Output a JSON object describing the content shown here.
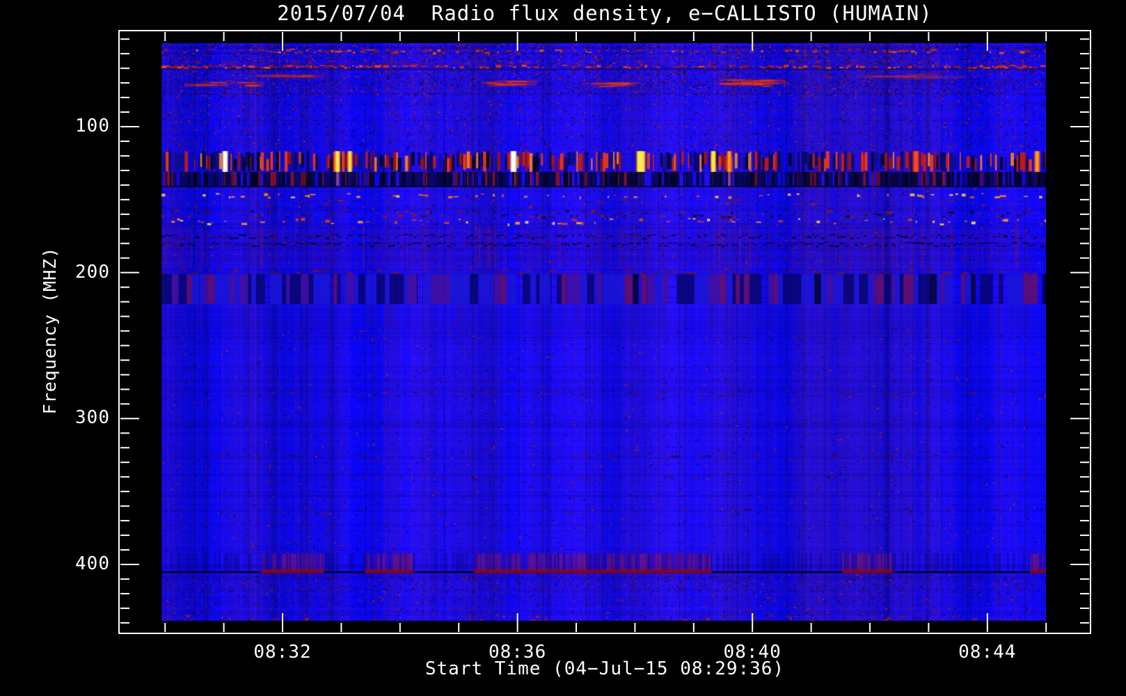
{
  "title": "2015/07/04  Radio flux density, e−CALLISTO (HUMAIN)",
  "axes": {
    "x": {
      "label": "Start Time (04−Jul−15 08:29:36)",
      "ticks": [
        "08:32",
        "08:36",
        "08:40",
        "08:44"
      ]
    },
    "y": {
      "label": "Frequency (MHZ)",
      "ticks": [
        {
          "label": "100",
          "mhz": 100
        },
        {
          "label": "200",
          "mhz": 200
        },
        {
          "label": "300",
          "mhz": 300
        },
        {
          "label": "400",
          "mhz": 400
        }
      ]
    }
  },
  "colors": {
    "background": "#000000",
    "frame": "#ffffff",
    "text": "#ffffff",
    "base_blue": "#1717e8",
    "dark_navy": "#000080",
    "rfi_red": "#cc2200",
    "rfi_orange": "#ff8800",
    "rfi_yellow": "#ffee55",
    "rfi_white": "#ffffff",
    "rfi_purple": "#7a14a0"
  },
  "chart_data": {
    "type": "heatmap",
    "title": "2015/07/04  Radio flux density, e−CALLISTO (HUMAIN)",
    "xlabel": "Start Time (04−Jul−15 08:29:36)",
    "ylabel": "Frequency (MHZ)",
    "start_time": "04-Jul-15 08:29:36",
    "x_tick_labels": [
      "08:32",
      "08:36",
      "08:40",
      "08:44"
    ],
    "x_minor_tick_interval_min": 1,
    "x_major_tick_interval_min": 4,
    "y_tick_labels_mhz": [
      100,
      200,
      300,
      400
    ],
    "y_minor_tick_interval_mhz": 10,
    "freq_range_mhz": [
      42.8,
      438.6
    ],
    "freq_axis_inverted_low_at_top": true,
    "background_character": "uniform blue with fine vertical striping noise",
    "speckle_zones": [
      {
        "f": [
          43.0,
          78.5
        ],
        "count": 9000
      },
      {
        "f": [
          78.5,
          116.5
        ],
        "count": 3800
      },
      {
        "f": [
          141.0,
          196.0
        ],
        "count": 2600
      },
      {
        "f": [
          237.5,
          392.0
        ],
        "count": 5200
      },
      {
        "f": [
          406.0,
          438.5
        ],
        "count": 2600
      }
    ],
    "rfi_bands": [
      {
        "f": [
          46.5,
          49.5
        ],
        "type": "dash_row",
        "palette": "red",
        "density": 0.4,
        "strong": [
          [
            0.1,
            0.155
          ],
          [
            0.175,
            0.235
          ],
          [
            0.82,
            0.87
          ]
        ],
        "desc": "speckled red RFI row near top"
      },
      {
        "f": [
          54.0,
          56.5
        ],
        "type": "dash_row",
        "palette": "red_sparse",
        "density": 0.13,
        "desc": "sparse fine red dots"
      },
      {
        "f": [
          57.5,
          59.7
        ],
        "type": "dash_row",
        "palette": "red_bright",
        "density": 0.5,
        "strong": [
          [
            0.0,
            0.24
          ],
          [
            0.67,
            0.72
          ],
          [
            0.91,
            1.0
          ]
        ],
        "underline": true,
        "desc": "thin bright red dashed line"
      },
      {
        "f": [
          64.5,
          66.5
        ],
        "type": "streaks",
        "alpha": 0.4,
        "segments": [
          [
            0.12,
            0.19
          ],
          [
            0.8,
            0.91
          ]
        ],
        "desc": "faint red fuzz streaks"
      },
      {
        "f": [
          68.0,
          72.5
        ],
        "type": "streaks",
        "alpha": 1.0,
        "segments": [
          [
            0.03,
            0.18
          ],
          [
            0.355,
            0.405
          ],
          [
            0.487,
            0.545
          ],
          [
            0.635,
            0.69
          ]
        ],
        "desc": "strong elongated red streaks"
      },
      {
        "f": [
          116.8,
          131.0
        ],
        "type": "rfi_strong",
        "desc": "strongest RFI band: red/navy bars with white-yellow saturated columns",
        "bright_columns": [
          [
            0.072,
            "white",
            4
          ],
          [
            0.199,
            "yellow",
            4
          ],
          [
            0.213,
            "yellow",
            3
          ],
          [
            0.398,
            "white",
            5
          ],
          [
            0.542,
            "yellow",
            9
          ],
          [
            0.624,
            "yellow",
            4
          ],
          [
            0.642,
            "orange",
            4
          ],
          [
            0.853,
            "bright_red",
            6
          ],
          [
            0.99,
            "orange",
            5
          ]
        ]
      },
      {
        "f": [
          131.0,
          141.0
        ],
        "type": "rfi_dark",
        "desc": "dark navy/black bar band with red bars"
      },
      {
        "f": [
          145.5,
          148.5
        ],
        "type": "dash_row",
        "palette": "orange",
        "density": 0.22,
        "desc": "orange dotted row"
      },
      {
        "f": [
          149.5,
          155.0
        ],
        "type": "dash_row",
        "palette": "red_sparse",
        "density": 0.1
      },
      {
        "f": [
          157.0,
          162.0
        ],
        "type": "dash_row",
        "palette": "dark_red_mix",
        "density": 0.55,
        "desc": "dark+red dashed band"
      },
      {
        "f": [
          162.5,
          167.0
        ],
        "type": "dash_row",
        "palette": "orange_bright",
        "density": 0.28,
        "desc": "bright orange dash row"
      },
      {
        "f": [
          168.5,
          196.5
        ],
        "type": "stripe_fine",
        "desc": "fine blue/purple vertical striping"
      },
      {
        "f": [
          173.5,
          177.0
        ],
        "type": "dark_dash_line"
      },
      {
        "f": [
          179.0,
          182.5
        ],
        "type": "dark_dash_line"
      },
      {
        "f": [
          196.8,
          200.6
        ],
        "type": "dash_row",
        "palette": "maroon",
        "density": 0.5
      },
      {
        "f": [
          201.0,
          221.5
        ],
        "type": "stripe_wide",
        "desc": "broad band of wide navy/blue/purple columns"
      },
      {
        "f": [
          221.5,
          237.5
        ],
        "type": "stripe_mild"
      },
      {
        "f": [
          281.0,
          284.5
        ],
        "type": "dash_row",
        "palette": "dark_red_faint",
        "density": 0.3
      },
      {
        "f": [
          323.0,
          327.0
        ],
        "type": "dash_row",
        "palette": "dark_red_faint",
        "density": 0.32
      },
      {
        "f": [
          339.0,
          342.0
        ],
        "type": "dash_row",
        "palette": "dark_red_faint",
        "density": 0.22
      },
      {
        "f": [
          361.0,
          365.0
        ],
        "type": "dash_row",
        "palette": "dark_red_faint",
        "density": 0.12
      },
      {
        "f": [
          392.5,
          405.5
        ],
        "type": "segmented_purple",
        "segments": [
          [
            0.113,
            0.183
          ],
          [
            0.23,
            0.284
          ],
          [
            0.353,
            0.622
          ],
          [
            0.77,
            0.826
          ],
          [
            0.982,
            1.0
          ]
        ],
        "desc": "~400 MHz band: purple-red striped blocks with dark red base line"
      },
      {
        "f": [
          407.0,
          419.0
        ],
        "type": "mottled"
      },
      {
        "f": [
          434.5,
          438.5
        ],
        "type": "dash_row",
        "palette": "red_sparse",
        "density": 0.22,
        "strong": [
          [
            0.4,
            0.435
          ],
          [
            0.615,
            0.645
          ],
          [
            0.795,
            0.83
          ]
        ]
      }
    ]
  }
}
